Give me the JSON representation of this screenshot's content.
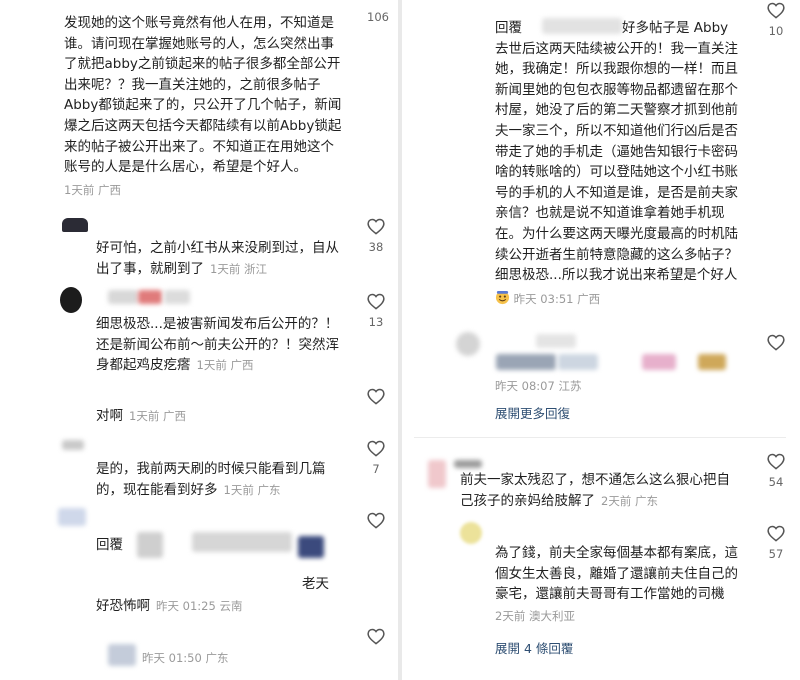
{
  "left": {
    "top_comment": {
      "text": "发现她的这个账号竟然有他人在用，不知道是\n谁。请问现在掌握她账号的人，怎么突然出事\n了就把abby之前锁起来的帖子很多都全部公开\n出来呢？？我一直关注她的，之前很多帖子\nAbby都锁起来了的，只公开了几个帖子，新闻\n爆之后这两天包括今天都陆续有以前Abby锁起\n来的帖子被公开出来了。不知道正在用她这个\n账号的人是是什么居心，希望是个好人。",
      "meta": "1天前 广西",
      "likes": "106"
    },
    "c1": {
      "text": "好可怕，之前小红书从来没刷到过，自从\n出了事，就刷到了",
      "meta": "1天前 浙江",
      "likes": "38"
    },
    "c2": {
      "text": "细思极恐...是被害新闻发布后公开的？！\n还是新闻公布前～前夫公开的？！突然浑\n身都起鸡皮疙瘩",
      "meta": "1天前 广西",
      "likes": "13"
    },
    "c3": {
      "text": "对啊",
      "meta": "1天前 广西"
    },
    "c4": {
      "text": "是的，我前两天刷的时候只能看到几篇\n的，现在能看到好多",
      "meta": "1天前 广东",
      "likes": "7"
    },
    "c5": {
      "reply_label": "回覆",
      "tail": "老天",
      "text": "好恐怖啊",
      "meta": "昨天 01:25 云南"
    },
    "c6": {
      "meta": "昨天 01:50 广东"
    }
  },
  "right": {
    "c1": {
      "reply_label": "回覆",
      "text_head": "好多帖子是 Abby",
      "text": "去世后这两天陆续被公开的！我一直关注\n她，我确定！所以我跟你想的一样！而且\n新闻里她的包包衣服等物品都遗留在那个\n村屋，她没了后的第二天警察才抓到他前\n夫一家三个，所以不知道他们行凶后是否\n带走了她的手机走（逼她告知银行卡密码\n啥的转账啥的）可以登陆她这个小红书账\n号的手机的人不知道是谁，是否是前夫家\n亲信？也就是说不知道谁拿着她手机现\n在。为什么要这两天曝光度最高的时机陆\n续公开逝者生前特意隐藏的这么多帖子？\n细思极恐...所以我才说出来希望是个好人",
      "meta": "昨天 03:51 广西",
      "likes": "10"
    },
    "c2": {
      "meta": "昨天 08:07 江苏"
    },
    "expand1": "展開更多回復",
    "c3": {
      "text": "前夫一家太残忍了，想不通怎么这么狠心把自\n己孩子的亲妈给肢解了",
      "meta": "2天前 广东",
      "likes": "54"
    },
    "c4": {
      "text": "為了錢，前夫全家每個基本都有案底，這\n個女生太善良，離婚了還讓前夫住自己的\n豪宅，還讓前夫哥哥有工作當她的司機",
      "meta": "2天前 澳大利亚",
      "likes": "57"
    },
    "expand2": "展開 4 條回覆"
  },
  "colors": {
    "link": "#2f4f73",
    "meta": "#9a9a9a",
    "text": "#1f1f1f"
  },
  "icons": [
    "heart-icon",
    "emoji-icon",
    "avatar"
  ]
}
